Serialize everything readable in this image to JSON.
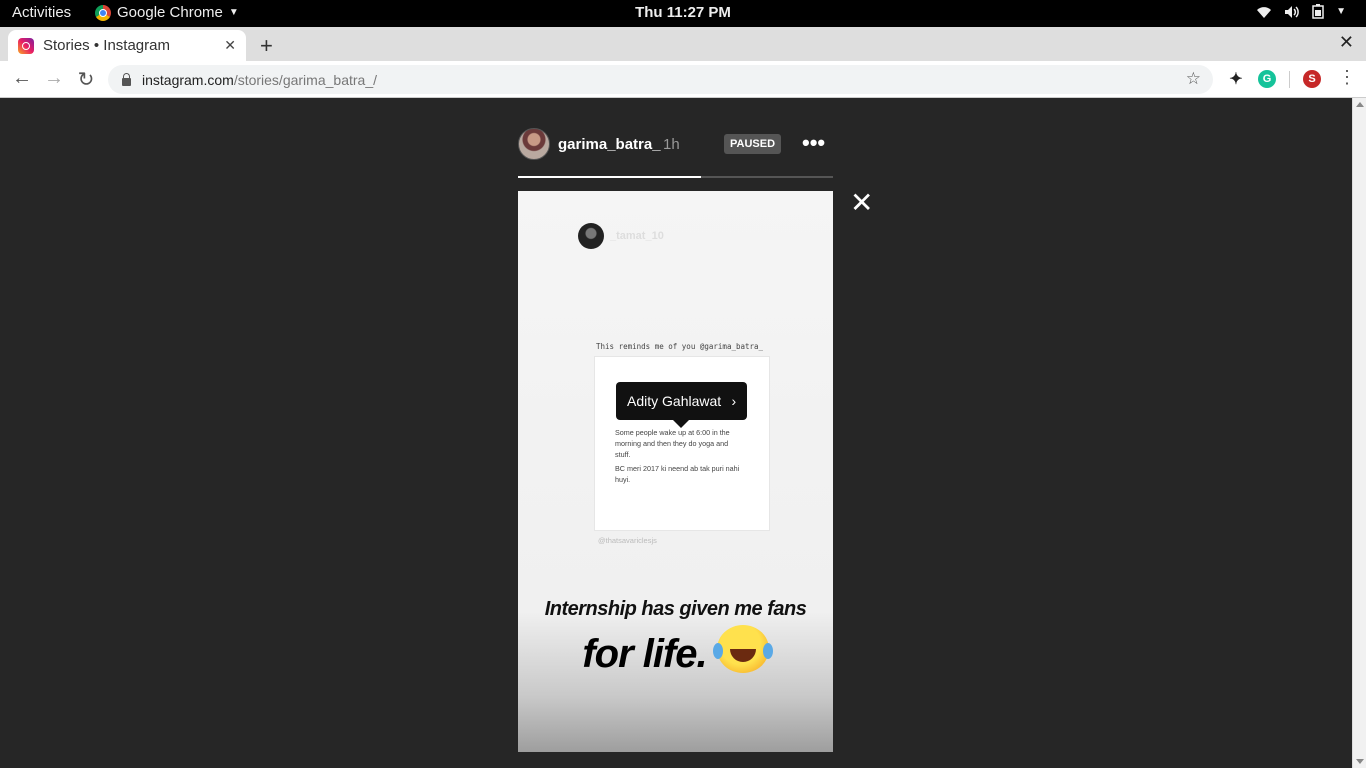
{
  "system": {
    "activities": "Activities",
    "app_name": "Google Chrome",
    "clock": "Thu 11:27 PM"
  },
  "browser": {
    "tab_title": "Stories • Instagram",
    "url_host": "instagram.com",
    "url_path": "/stories/garima_batra_/",
    "profile_initial": "S"
  },
  "story": {
    "username": "garima_batra_",
    "time_ago": "1h",
    "status_badge": "PAUSED",
    "progress_fraction": 0.58,
    "inner_username": "_tamat_10",
    "caption": "This reminds me of you @garima_batra_",
    "tweet_lines": [
      "Some people wake up at 6:00 in the morning and then they do yoga and stuff.",
      "BC meri 2017 ki neend ab tak puri nahi huyi."
    ],
    "source_handle": "@thatsavariclesjs",
    "tag_label": "Adity Gahlawat",
    "text_line1": "Internship has given me fans",
    "text_line2": "for life."
  },
  "icons": {
    "back": "arrow-left-icon",
    "forward": "arrow-right-icon",
    "reload": "reload-icon",
    "bookmark": "star-icon",
    "close_story": "close-icon",
    "emoji": "face-with-tears-of-joy-icon"
  }
}
